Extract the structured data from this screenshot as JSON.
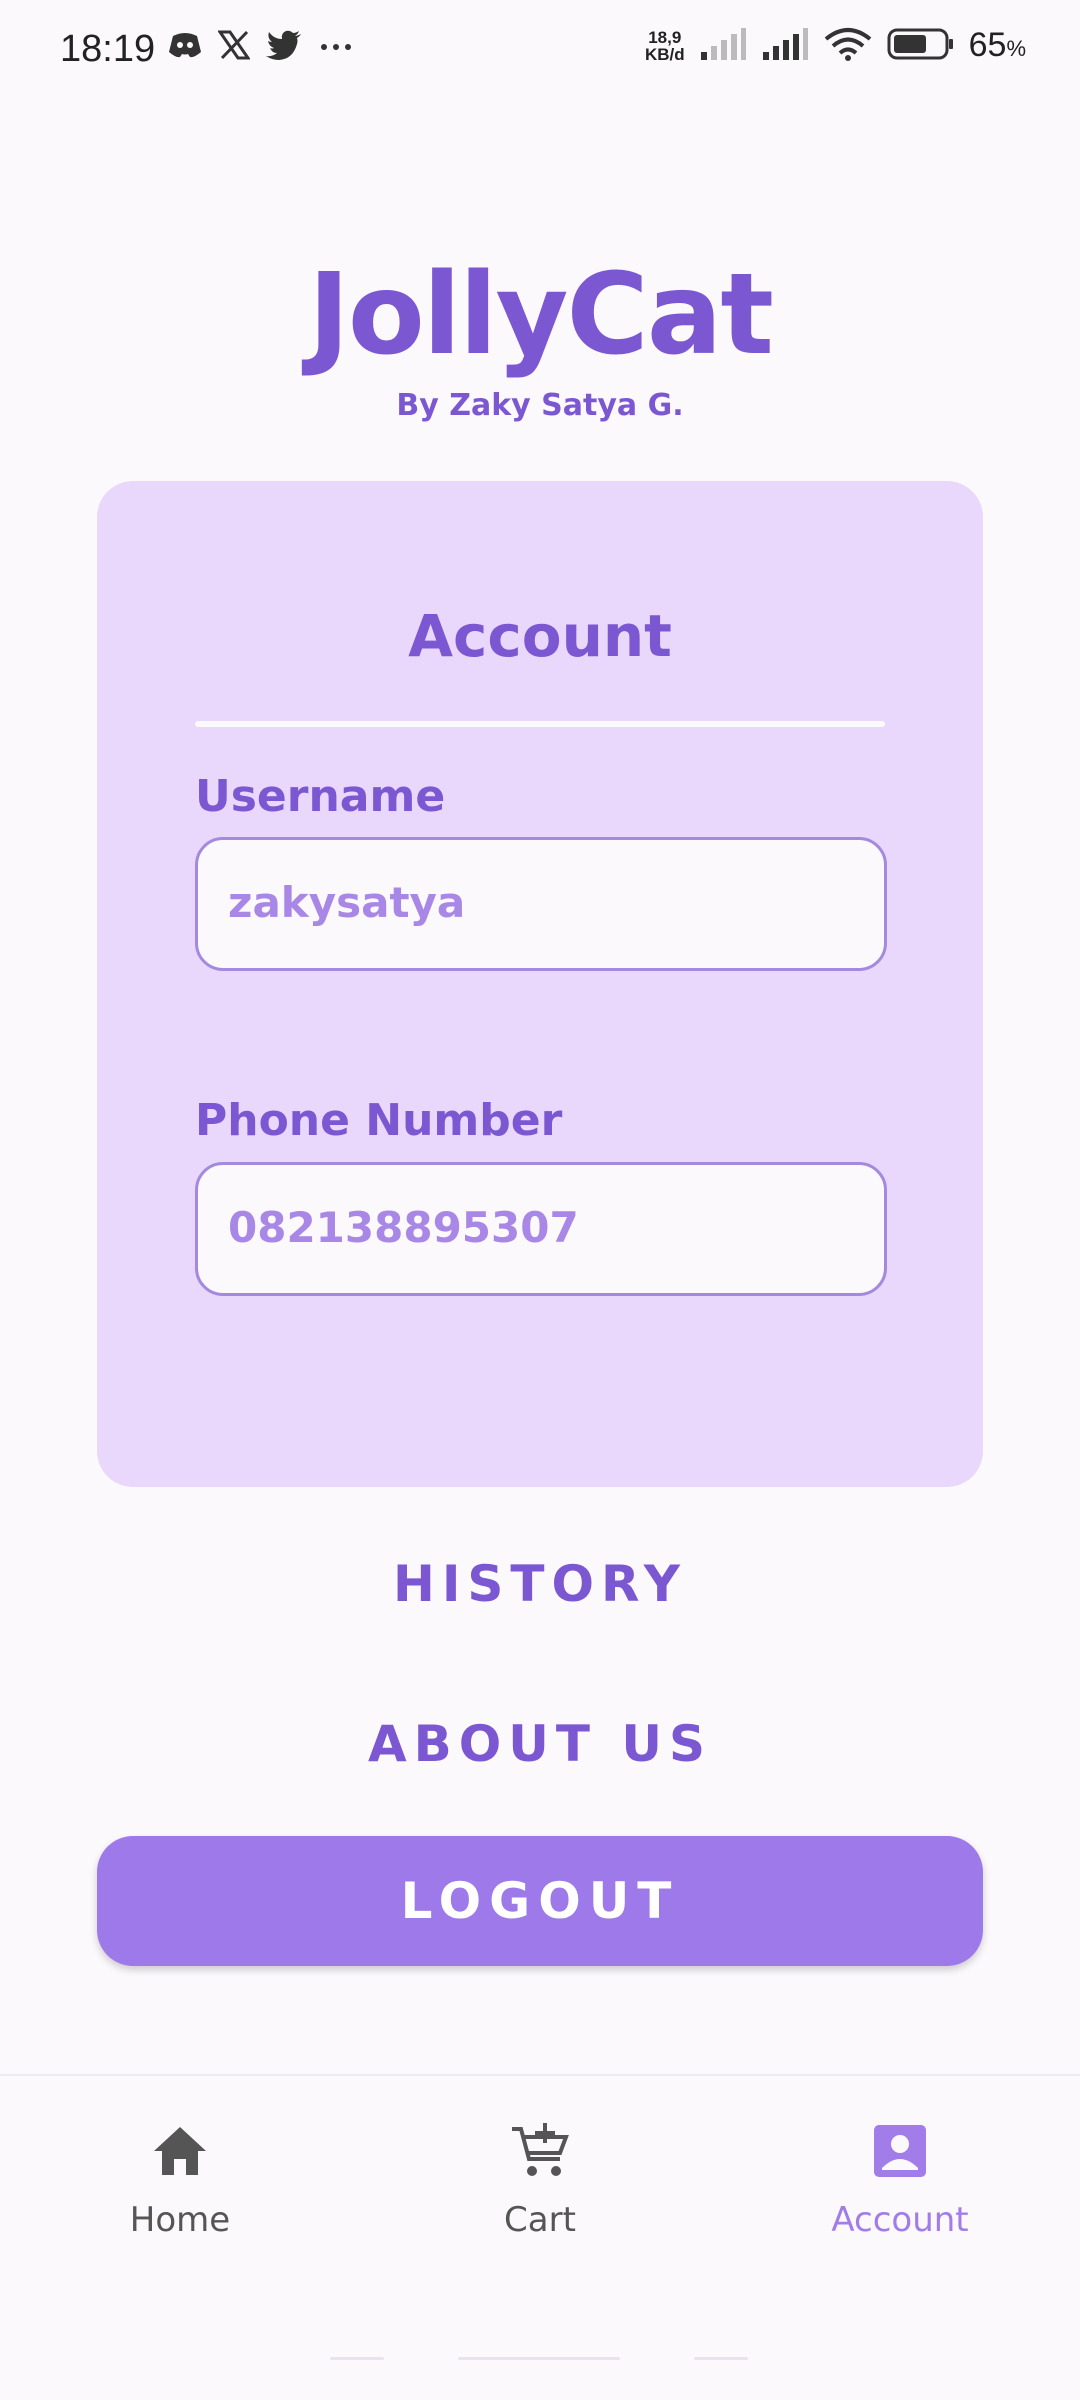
{
  "status_bar": {
    "time": "18:19",
    "net_speed_value": "18,9",
    "net_speed_unit": "KB/d",
    "battery_percent": "65",
    "battery_symbol": "%",
    "notif_icons": [
      "discord-icon",
      "x-icon",
      "twitter-icon",
      "more-icon"
    ]
  },
  "brand": {
    "title": "JollyCat",
    "subtitle": "By Zaky Satya G."
  },
  "account_card": {
    "title": "Account",
    "username_label": "Username",
    "username_value": "zakysatya",
    "phone_label": "Phone Number",
    "phone_value": "082138895307"
  },
  "actions": {
    "history": "HISTORY",
    "about_us": "ABOUT US",
    "logout": "LOGOUT"
  },
  "bottom_nav": {
    "items": [
      {
        "label": "Home",
        "icon": "home-icon"
      },
      {
        "label": "Cart",
        "icon": "cart-add-icon"
      },
      {
        "label": "Account",
        "icon": "account-box-icon",
        "active": true
      }
    ]
  },
  "colors": {
    "primary": "#7b57d2",
    "card_bg": "#e9d8fb",
    "button_bg": "#9d79ea",
    "page_bg": "#fcf9fd"
  }
}
